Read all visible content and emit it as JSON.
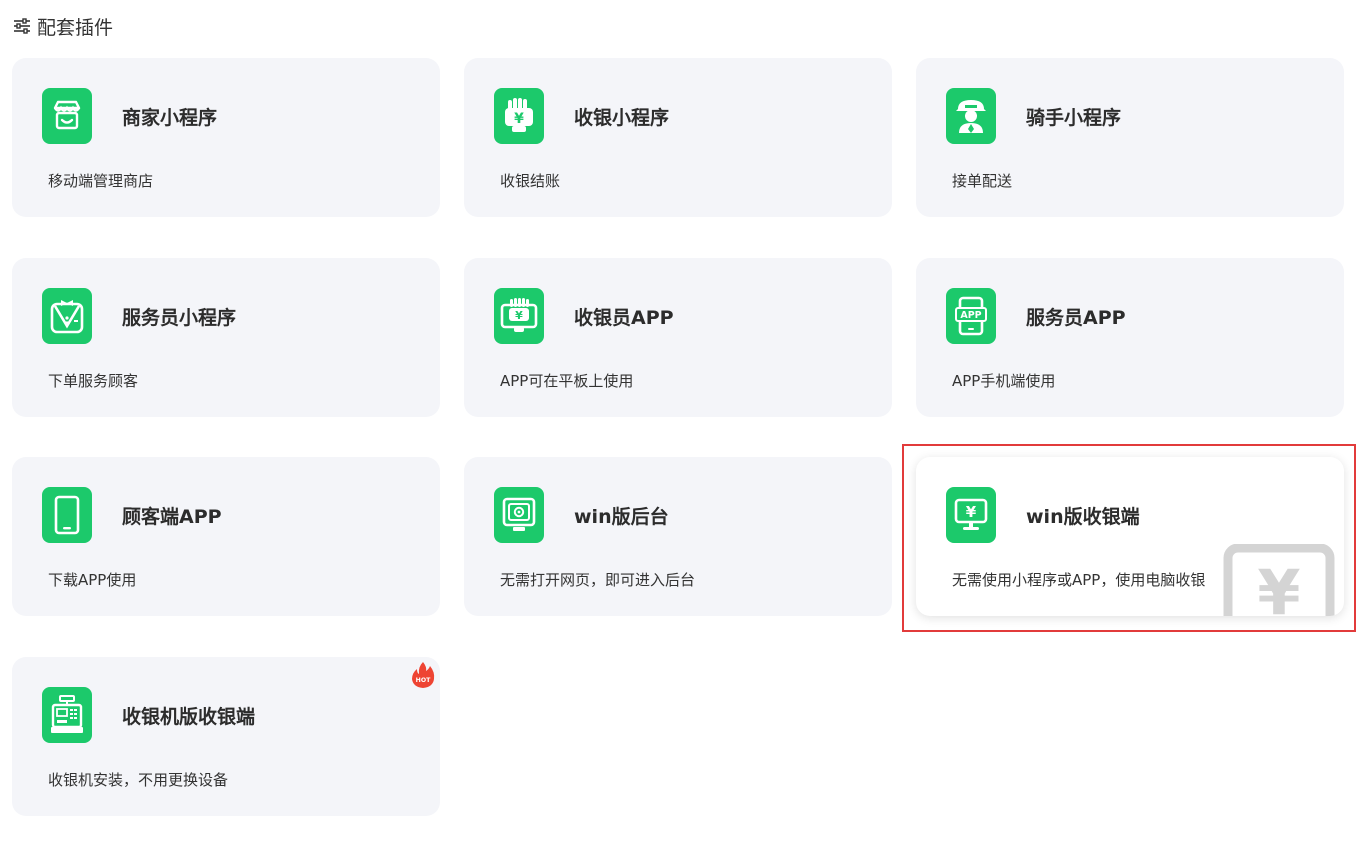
{
  "header": {
    "title": "配套插件",
    "icon": "sliders-icon"
  },
  "colors": {
    "accent": "#1cc96b",
    "card_bg": "#f4f5f9",
    "highlight_border": "#e23b3b",
    "hot": "#ee4433"
  },
  "cards": [
    {
      "name": "商家小程序",
      "desc": "移动端管理商店",
      "icon": "shop-icon"
    },
    {
      "name": "收银小程序",
      "desc": "收银结账",
      "icon": "cashier-hand-icon"
    },
    {
      "name": "骑手小程序",
      "desc": "接单配送",
      "icon": "rider-icon"
    },
    {
      "name": "服务员小程序",
      "desc": "下单服务顾客",
      "icon": "waiter-icon"
    },
    {
      "name": "收银员APP",
      "desc": "APP可在平板上使用",
      "icon": "cashier-tablet-icon"
    },
    {
      "name": "服务员APP",
      "desc": "APP手机端使用",
      "icon": "phone-app-icon",
      "icon_text": "APP"
    },
    {
      "name": "顾客端APP",
      "desc": "下载APP使用",
      "icon": "phone-icon"
    },
    {
      "name": "win版后台",
      "desc": "无需打开网页，即可进入后台",
      "icon": "gear-monitor-icon"
    },
    {
      "name": "win版收银端",
      "desc": "无需使用小程序或APP，使用电脑收银",
      "icon": "yen-monitor-icon",
      "selected": true
    },
    {
      "name": "收银机版收银端",
      "desc": "收银机安装，不用更换设备",
      "icon": "cash-register-icon",
      "badge": "HOT"
    }
  ]
}
